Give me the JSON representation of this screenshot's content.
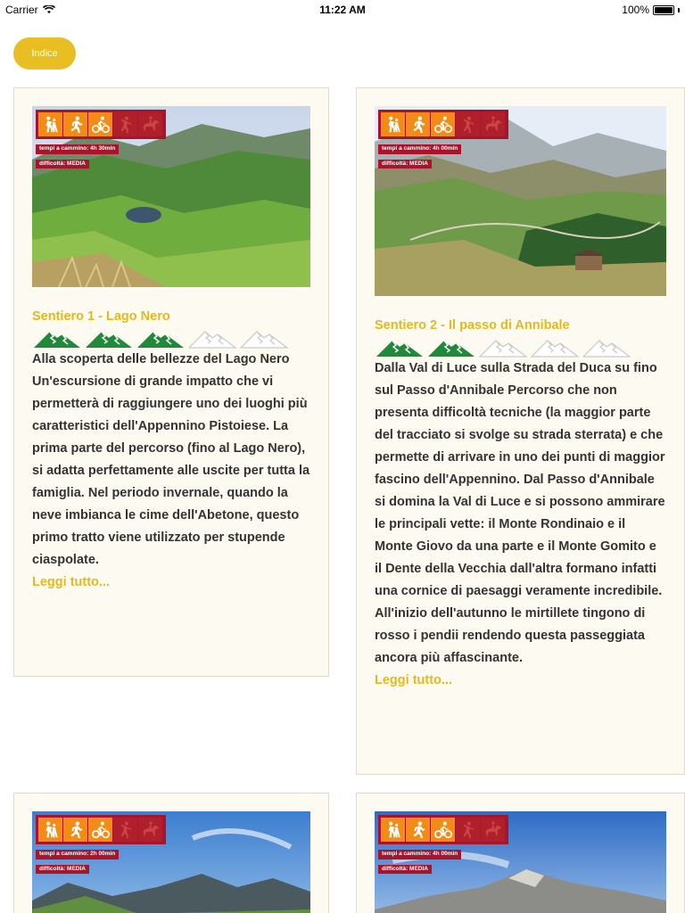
{
  "status_bar": {
    "carrier": "Carrier",
    "time": "11:22 AM",
    "battery": "100%"
  },
  "nav": {
    "index_label": "Indice"
  },
  "labels": {
    "read_more": "Leggi tutto..."
  },
  "cards": [
    {
      "walk_time": "tempi a cammino: 4h 30min",
      "difficulty": "difficoltà: MEDIA",
      "title": "Sentiero 1 - Lago Nero",
      "rating": 3,
      "rating_max": 5,
      "subtitle": "Alla scoperta delle bellezze del Lago Nero",
      "description": "Un'escursione di grande impatto che vi permetterà di raggiungere uno dei luoghi più caratteristici dell'Appennino Pistoiese. La prima parte del percorso (fino al Lago Nero), si adatta perfettamente alle uscite per tutta la famiglia. Nel periodo invernale, quando la neve imbianca le cime dell'Abetone, questo primo tratto viene utilizzato per stupende ciaspolate."
    },
    {
      "walk_time": "tempi a cammino: 4h 00min",
      "difficulty": "difficoltà: MEDIA",
      "title": "Sentiero 2 - Il passo di Annibale",
      "rating": 2,
      "rating_max": 5,
      "description": "Dalla Val di Luce sulla Strada del Duca su fino sul Passo d'Annibale Percorso che non presenta difficoltà tecniche (la maggior parte del tracciato si svolge su strada sterrata) e che permette di arrivare in uno dei punti di maggior fascino dell'Appennino. Dal Passo d'Annibale si domina la Val di Luce e si possono ammirare le principali vette: il Monte Rondinaio e il Monte Giovo da una parte e il Monte Gomito e il Dente della Vecchia dall'altra formano infatti una cornice di paesaggi veramente incredibile. All'inizio dell'autunno le mirtillete tingono di rosso i pendii rendendo questa passeggiata ancora più affascinante."
    },
    {
      "walk_time": "tempi a cammino: 2h 00min",
      "difficulty": "difficoltà: MEDIA"
    },
    {
      "walk_time": "tempi a cammino: 4h 00min",
      "difficulty": "difficoltà: MEDIA"
    }
  ],
  "activities": [
    "hiking-icon",
    "running-icon",
    "cycling-icon",
    "climbing-icon",
    "horse-riding-icon"
  ],
  "colors": {
    "accent": "#e3b91d",
    "button": "#e8be22",
    "badge": "#a8152b",
    "active_icon": "#f28c16",
    "mountain_on": "#1f8a3a"
  }
}
